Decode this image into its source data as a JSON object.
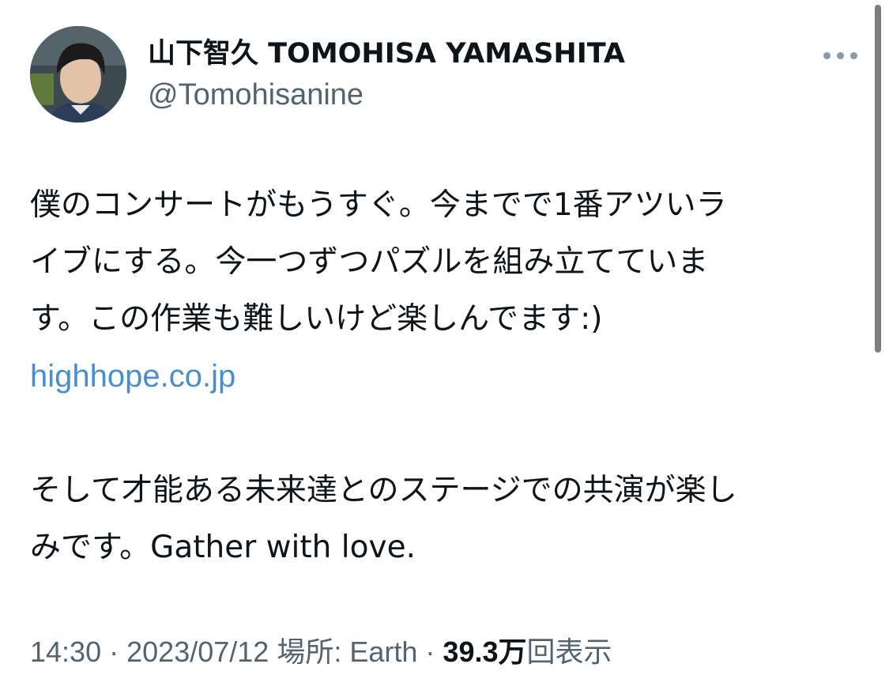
{
  "author": {
    "display_name": "山下智久 TOMOHISA YAMASHITA",
    "handle": "@Tomohisanine",
    "avatar_icon": "avatar-photo"
  },
  "more_icon": "more-dots-icon",
  "tweet": {
    "lines_p1": [
      "僕のコンサートがもうすぐ。今までで1番アツいラ",
      "イブにする。今一つずつパズルを組み立てていま",
      "す。この作業も難しいけど楽しんでます:)"
    ],
    "link": "highhope.co.jp",
    "lines_p2": [
      "そして才能ある未来達とのステージでの共演が楽し",
      "みです。Gather with love."
    ]
  },
  "meta": {
    "time": "14:30",
    "separator": "·",
    "date": "2023/07/12",
    "location_label": "場所: Earth",
    "views_count": "39.3",
    "views_unit": "万",
    "views_label": "回表示"
  },
  "colors": {
    "link": "#4a8ecd",
    "secondary_text": "#536471",
    "primary_text": "#0f1419"
  }
}
